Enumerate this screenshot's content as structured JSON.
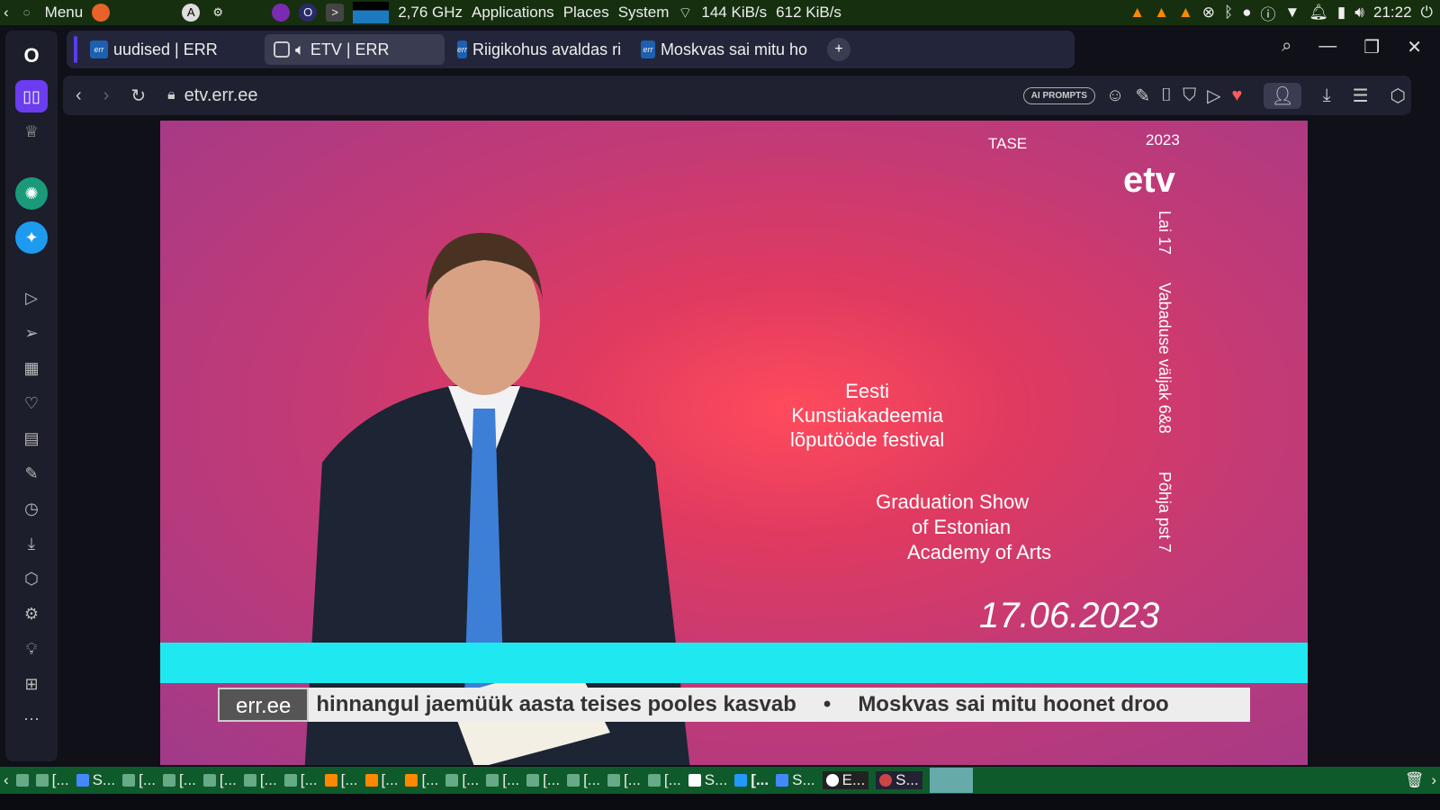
{
  "top_panel": {
    "menu": "Menu",
    "cpu_freq": "2,76 GHz",
    "applications": "Applications",
    "places": "Places",
    "system": "System",
    "net_down": "144 KiB/s",
    "net_up": "612 KiB/s",
    "clock": "21:22"
  },
  "tabs": [
    {
      "label": "uudised | ERR",
      "favicon": "err"
    },
    {
      "label": "ETV | ERR",
      "favicon": "err",
      "audio": true,
      "active": true
    },
    {
      "label": "Riigikohus avaldas ri",
      "favicon": "err"
    },
    {
      "label": "Moskvas sai mitu ho",
      "favicon": "err"
    }
  ],
  "address": {
    "url": "etv.err.ee",
    "ai_prompts": "AI PROMPTS"
  },
  "video": {
    "logo": "etv",
    "tase": "TASE",
    "year": "2023",
    "festival_et": [
      "Eesti",
      "Kunstiakadeemia",
      "lõputööde festival"
    ],
    "festival_en": [
      "Graduation Show",
      "of Estonian",
      "Academy of Arts"
    ],
    "vertical": [
      "Lai 17",
      "Vabaduse väljak 6&8",
      "Põhja pst 7"
    ],
    "date": "17.06.2023",
    "ticker_brand": "err.ee",
    "ticker_items": [
      "hinnangul jaemüük aasta teises pooles kasvab",
      "Moskvas sai mitu hoonet droo"
    ],
    "ticker_sep": "•"
  },
  "taskbar": {
    "items": [
      "[...",
      "S...",
      "[...",
      "[...",
      "[...",
      "[...",
      "[...",
      "[...",
      "[...",
      "[...",
      "[...",
      "[...",
      "[...",
      "[...",
      "[...",
      "[...",
      "S...",
      "[...",
      "S...",
      "E...",
      "S..."
    ]
  }
}
